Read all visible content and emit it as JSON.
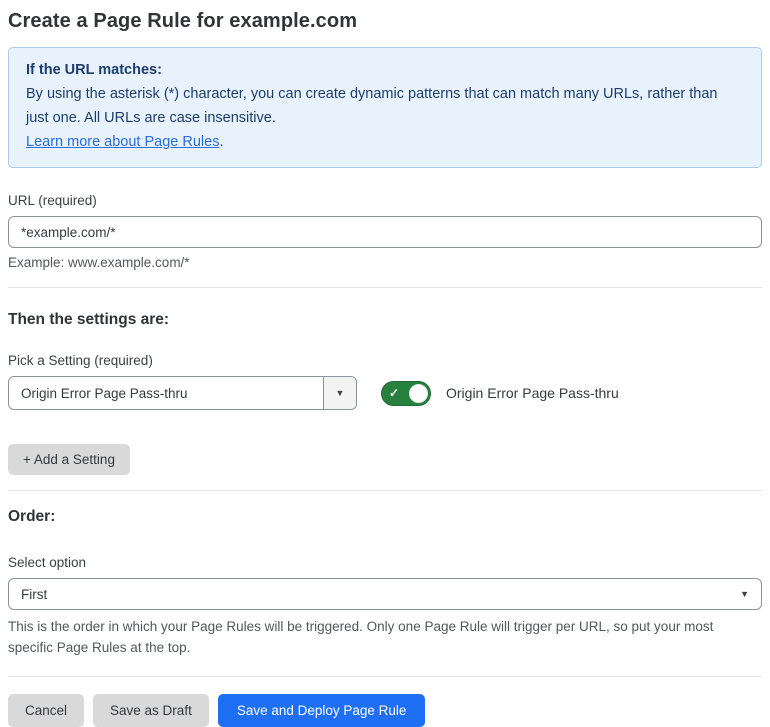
{
  "page": {
    "title": "Create a Page Rule for example.com"
  },
  "colors": {
    "info_box_bg": "#e8f2fc",
    "info_box_border": "#abcbee",
    "info_text": "#1d3d6d",
    "link_blue": "#2b6cd9",
    "toggle_green": "#27803e",
    "primary_button_blue": "#1f6ff5",
    "gray_button_bg": "#d9d9d9",
    "text_dark": "#36393f"
  },
  "info_box": {
    "heading": "If the URL matches:",
    "body": "By using the asterisk (*) character, you can create dynamic patterns that can match many URLs, rather than just one. All URLs are case insensitive.",
    "link": "Learn more about Page Rules",
    "link_suffix": "."
  },
  "url_field": {
    "label": "URL (required)",
    "value": "*example.com/*",
    "helper": "Example: www.example.com/*"
  },
  "settings_section": {
    "heading": "Then the settings are:",
    "picker_label": "Pick a Setting (required)",
    "picker_value": "Origin Error Page Pass-thru",
    "dropdown_icon": "▼",
    "toggle_state": "on",
    "toggle_check": "✓",
    "toggle_label": "Origin Error Page Pass-thru",
    "add_button": "+ Add a Setting"
  },
  "order_section": {
    "heading": "Order:",
    "select_label": "Select option",
    "select_value": "First",
    "dropdown_icon": "▼",
    "helper": "This is the order in which your Page Rules will be triggered. Only one Page Rule will trigger per URL, so put your most specific Page Rules at the top."
  },
  "footer": {
    "cancel": "Cancel",
    "save_draft": "Save as Draft",
    "save_deploy": "Save and Deploy Page Rule"
  }
}
